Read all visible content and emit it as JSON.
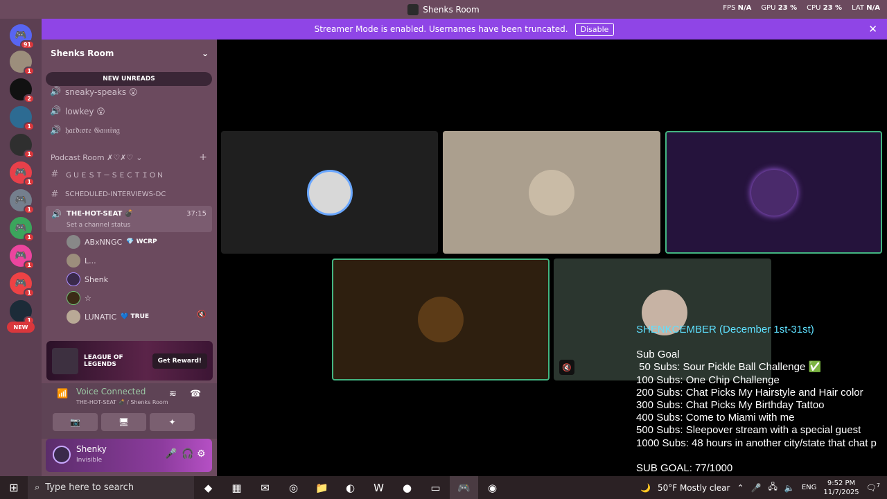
{
  "window": {
    "title": "Shenks Room",
    "stats": [
      {
        "label": "FPS",
        "value": "N/A"
      },
      {
        "label": "GPU",
        "value": "23 %"
      },
      {
        "label": "CPU",
        "value": "23 %"
      },
      {
        "label": "LAT",
        "value": "N/A"
      }
    ]
  },
  "banner": {
    "text": "Streamer Mode is enabled. Usernames have been truncated.",
    "button": "Disable"
  },
  "guilds": {
    "badges": [
      "91",
      "1",
      "2",
      "1",
      "1",
      "1",
      "1",
      "1",
      "1",
      "1",
      "1"
    ],
    "new_label": "NEW"
  },
  "sidebar": {
    "server_name": "Shenks Room",
    "new_unreads": "NEW UNREADS",
    "channels_top": [
      {
        "name": "sneaky-speaks 😮"
      },
      {
        "name": "lowkey 😮"
      },
      {
        "name": "𝔥𝔞𝔯𝔡𝔠𝔬𝔯𝔢 𝔊𝔞𝔪𝔦𝔫𝔤"
      }
    ],
    "category": "Podcast Room ✗♡✗♡",
    "text_channels": [
      "ＧＵＥＳＴ－ＳＥＣＴＩＯＮ",
      "SCHEDULED-INTERVIEWS-DC"
    ],
    "active_voice": {
      "name": "THE-HOT-SEAT 💣",
      "timer": "37:15",
      "status": "Set a channel status"
    },
    "members": [
      {
        "name": "ABxNNGC",
        "tag": "💎 WCRP"
      },
      {
        "name": "L..."
      },
      {
        "name": "Shenk"
      },
      {
        "name": "☆"
      },
      {
        "name": "LUNATIC",
        "tag": "💙 TRUE"
      }
    ],
    "promo": {
      "game": "LEAGUE OF LEGENDS",
      "button": "Get Reward!"
    },
    "voice": {
      "status": "Voice Connected",
      "location": "THE-HOT-SEAT 💣 / Shenks Room"
    },
    "user": {
      "name": "Shenky",
      "status": "Invisible"
    }
  },
  "overlay": {
    "title": "SHENKCEMBER (December 1st-31st)",
    "heading": "Sub Goal",
    "goals": [
      " 50 Subs: Sour Pickle Ball Challenge ✅",
      "100 Subs: One Chip Challenge",
      "200 Subs: Chat Picks My Hairstyle and Hair color",
      "300 Subs: Chat Picks My Birthday Tattoo",
      "400 Subs: Come to Miami with me",
      "500 Subs: Sleepover stream with a special guest",
      "1000 Subs: 48 hours in another city/state that chat p"
    ],
    "sub_goal": "SUB GOAL: 77/1000"
  },
  "taskbar": {
    "search_placeholder": "Type here to search",
    "weather": "50°F  Mostly clear",
    "lang": "ENG",
    "time": "9:52 PM",
    "date": "11/7/2025",
    "notif_count": "7"
  }
}
